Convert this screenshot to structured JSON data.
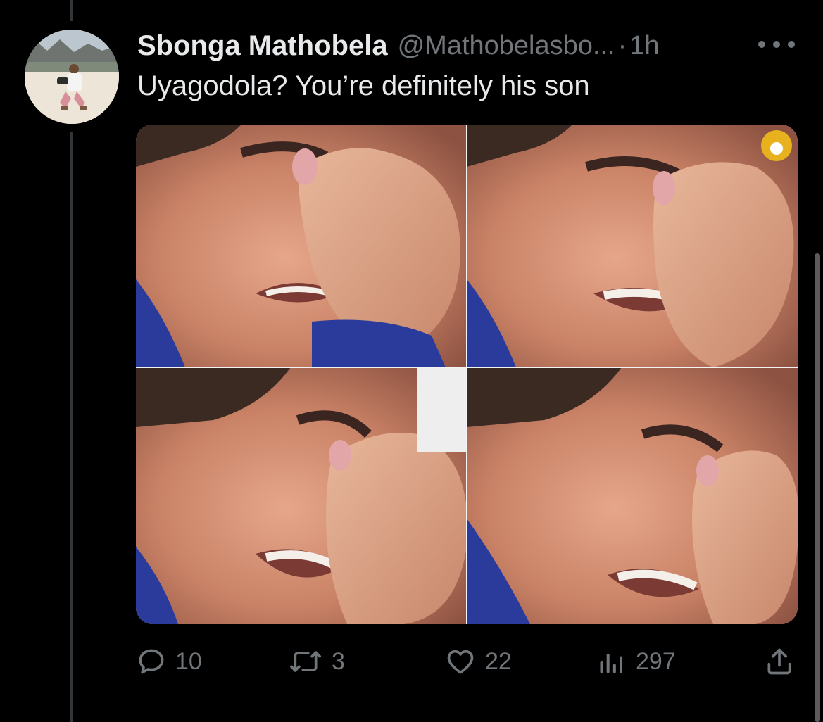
{
  "tweet": {
    "display_name": "Sbonga Mathobela",
    "handle": "@Mathobelasbo...",
    "separator": "·",
    "time": "1h",
    "text": "Uyagodola? You’re definitely his son"
  },
  "icons": {
    "more": "more-horizontal-icon",
    "reply": "reply-icon",
    "retweet": "retweet-icon",
    "like": "heart-icon",
    "views": "views-icon",
    "share": "share-icon"
  },
  "actions": {
    "replies": "10",
    "retweets": "3",
    "likes": "22",
    "views": "297"
  },
  "colors": {
    "background": "#000000",
    "primary_text": "#e7e9ea",
    "secondary_text": "#71767b",
    "thread_line": "#333639"
  }
}
